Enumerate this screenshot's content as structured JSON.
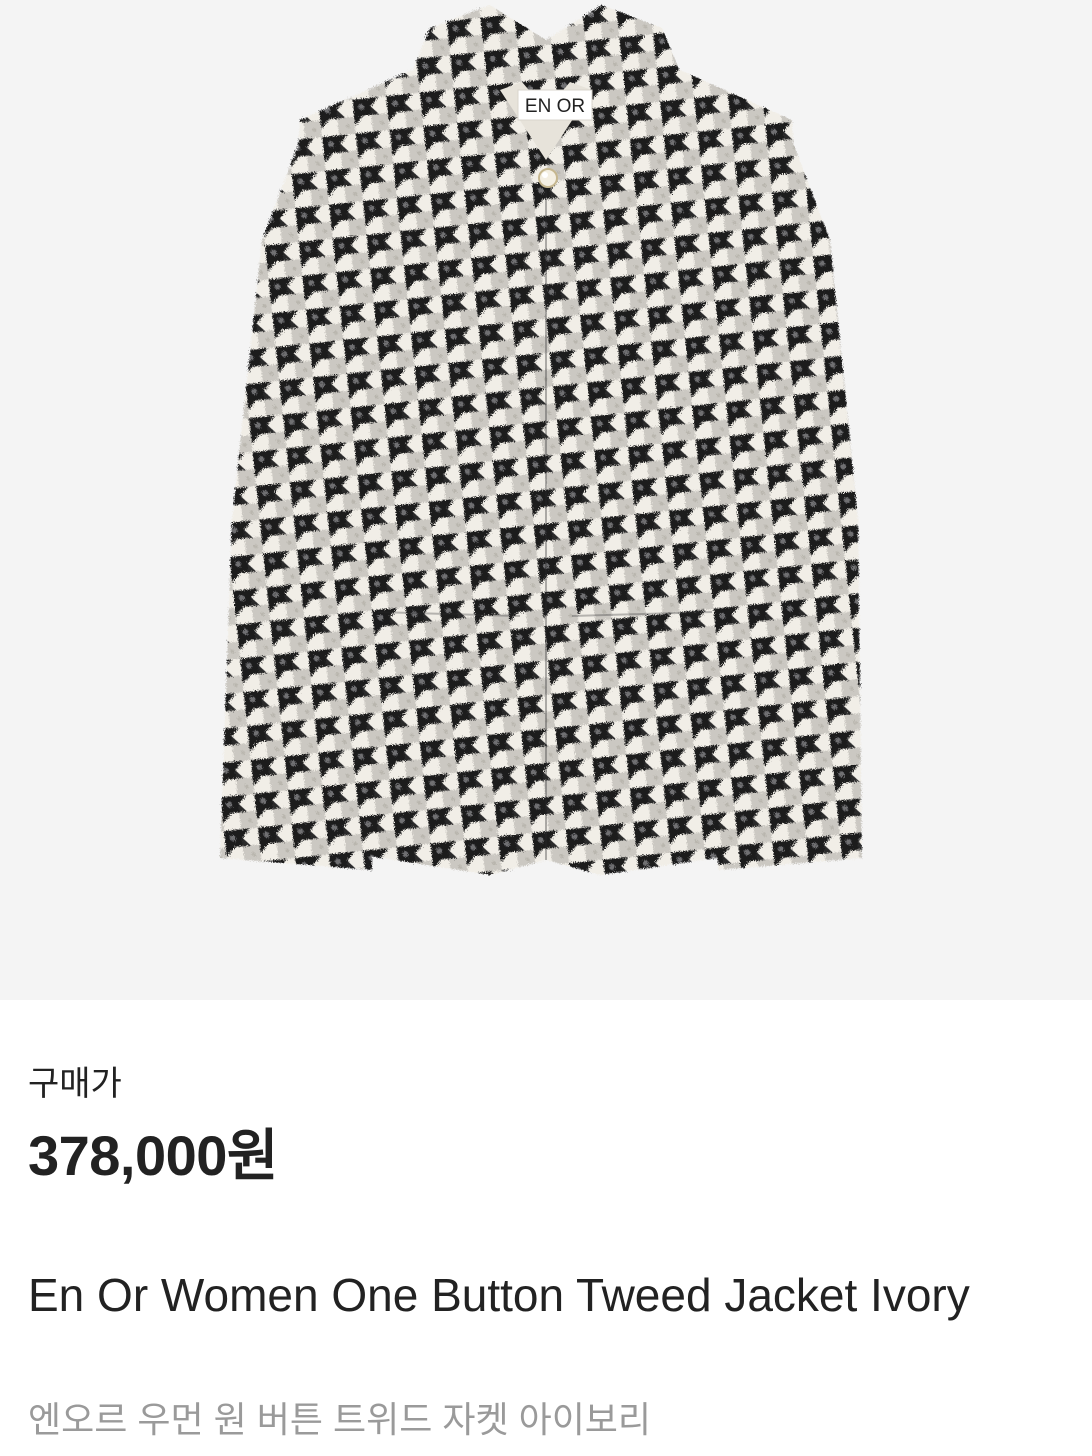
{
  "product_image": {
    "label_text": "EN OR",
    "background_color": "#f4f4f4",
    "pattern_colors": [
      "#1c1c1e",
      "#f1eee7",
      "#6f6f72"
    ]
  },
  "price_section": {
    "label": "구매가",
    "price": "378,000원"
  },
  "product": {
    "name_en": "En Or Women One Button Tweed Jacket Ivory",
    "name_ko": "엔오르 우먼 원 버튼 트위드 자켓 아이보리"
  }
}
